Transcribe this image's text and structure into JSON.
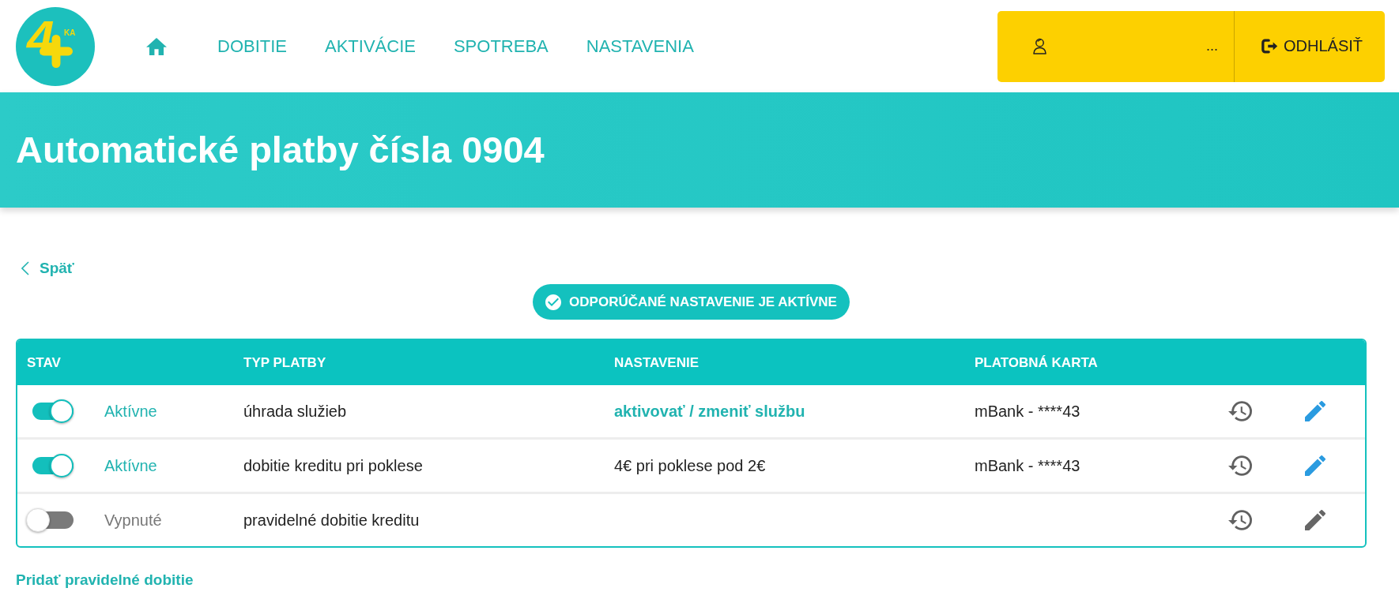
{
  "header": {
    "logo": {
      "digit": "4",
      "suffix": "KA"
    },
    "nav": [
      {
        "label": "DOBITIE"
      },
      {
        "label": "AKTIVÁCIE"
      },
      {
        "label": "SPOTREBA"
      },
      {
        "label": "NASTAVENIA"
      }
    ],
    "user": {
      "name": "..."
    },
    "logout": {
      "label": "ODHLÁSIŤ"
    }
  },
  "title": "Automatické platby čísla 0904",
  "back_link": {
    "label": "Späť"
  },
  "status_badge": {
    "label": "ODPORÚČANÉ NASTAVENIE JE AKTÍVNE"
  },
  "table": {
    "columns": [
      {
        "label": "STAV"
      },
      {
        "label": "TYP PLATBY"
      },
      {
        "label": "NASTAVENIE"
      },
      {
        "label": "PLATOBNÁ KARTA"
      }
    ],
    "rows": [
      {
        "on": true,
        "status": "Aktívne",
        "payment_type": "úhrada služieb",
        "setting": {
          "kind": "link",
          "text": "aktivovať / zmeniť službu"
        },
        "card": "mBank - ****43"
      },
      {
        "on": true,
        "status": "Aktívne",
        "payment_type": "dobitie kreditu pri poklese",
        "setting": {
          "kind": "text",
          "text": "4€ pri poklese pod 2€"
        },
        "card": "mBank - ****43"
      },
      {
        "on": false,
        "status": "Vypnuté",
        "payment_type": "pravidelné dobitie kreditu"
      }
    ]
  },
  "add_link": {
    "label": "Pridať pravidelné dobitie"
  }
}
